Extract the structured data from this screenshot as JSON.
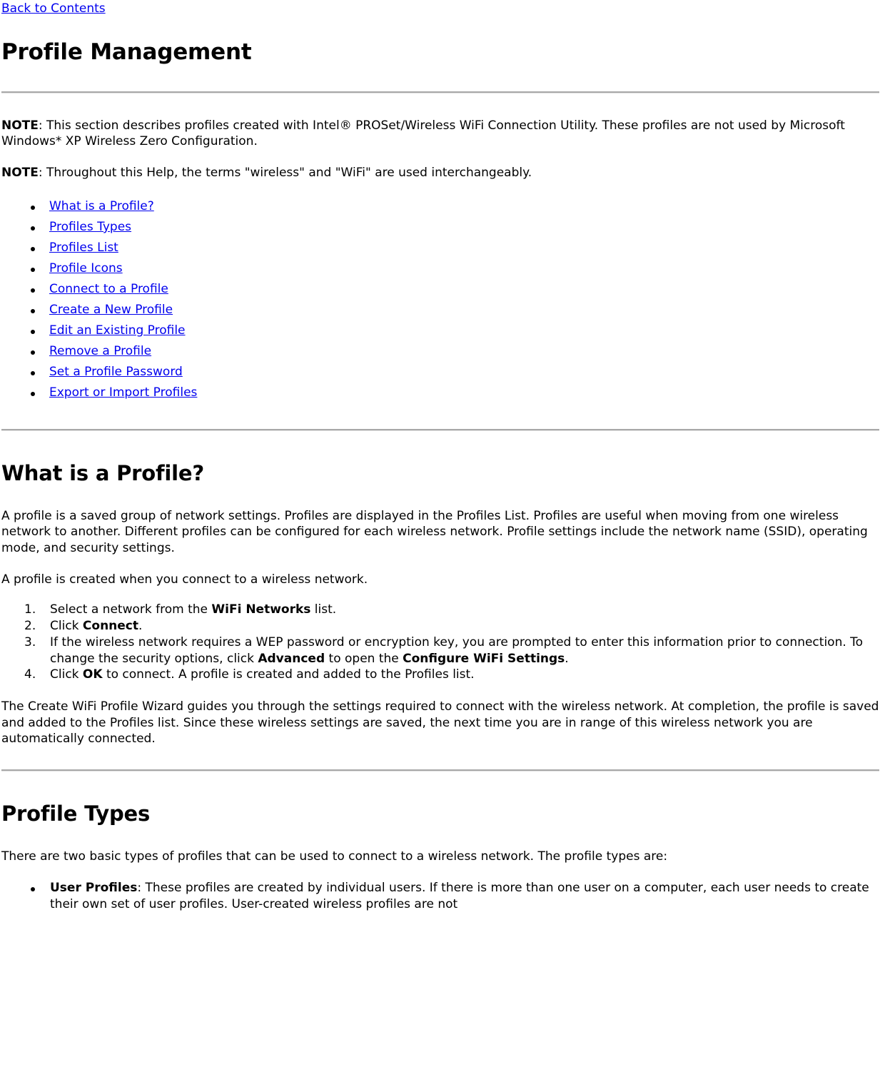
{
  "document": {
    "back_link": "Back to Contents",
    "title": "Profile Management"
  },
  "notes": [
    {
      "label": "NOTE",
      "text": ": This section describes profiles created with Intel® PROSet/Wireless WiFi Connection Utility. These profiles are not used by Microsoft Windows* XP Wireless Zero Configuration."
    },
    {
      "label": "NOTE",
      "text": ": Throughout this Help, the terms \"wireless\" and \"WiFi\" are used interchangeably."
    }
  ],
  "toc": {
    "items": [
      "What is a Profile?",
      "Profiles Types",
      "Profiles List",
      "Profile Icons",
      "Connect to a Profile",
      "Create a New Profile",
      "Edit an Existing Profile",
      "Remove a Profile",
      "Set a Profile Password",
      "Export or Import Profiles"
    ]
  },
  "what_is_a_profile": {
    "heading": "What is a Profile?",
    "paragraph_1": "A profile is a saved group of network settings. Profiles are displayed in the Profiles List. Profiles are useful when moving from one wireless network to another. Different profiles can be configured for each wireless network. Profile settings include the network name (SSID), operating mode, and security settings.",
    "paragraph_2": "A profile is created when you connect to a wireless network.",
    "steps": [
      {
        "pre": "Select a network from the ",
        "bold1": "WiFi Networks",
        "mid": " list.",
        "bold2": "",
        "post": ""
      },
      {
        "pre": "Click ",
        "bold1": "Connect",
        "mid": ".",
        "bold2": "",
        "post": ""
      },
      {
        "pre": "If the wireless network requires a WEP password or encryption key, you are prompted to enter this information prior to connection. To change the security options, click ",
        "bold1": "Advanced",
        "mid": " to open the ",
        "bold2": "Configure WiFi Settings",
        "post": "."
      },
      {
        "pre": "Click ",
        "bold1": "OK",
        "mid": " to connect. A profile is created and added to the Profiles list.",
        "bold2": "",
        "post": ""
      }
    ],
    "paragraph_3": "The Create WiFi Profile Wizard guides you through the settings required to connect with the wireless network. At completion, the profile is saved and added to the Profiles list. Since these wireless settings are saved, the next time you are in range of this wireless network you are automatically connected."
  },
  "profile_types": {
    "heading": "Profile Types",
    "intro": "There are two basic types of profiles that can be used to connect to a wireless network. The profile types are:",
    "items": [
      {
        "label": "User Profiles",
        "text": ": These profiles are created by individual users. If there is more than one user on a computer, each user needs to create their own set of user profiles. User-created wireless profiles are not"
      }
    ]
  },
  "colors": {
    "link": "#0000ee",
    "text": "#000000",
    "rule": "#a8a8a8",
    "background": "#ffffff"
  }
}
